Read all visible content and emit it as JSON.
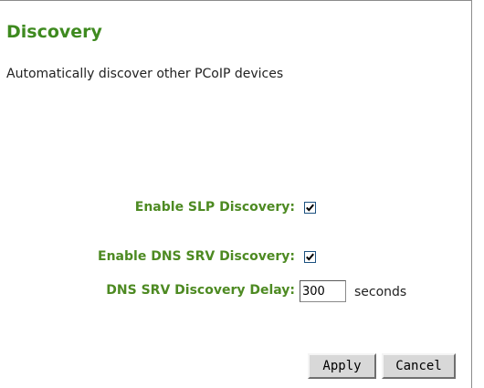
{
  "page": {
    "title": "Discovery",
    "description": "Automatically discover other PCoIP devices"
  },
  "form": {
    "slp": {
      "label": "Enable SLP Discovery:",
      "checked": true
    },
    "dns_srv": {
      "label": "Enable DNS SRV Discovery:",
      "checked": true
    },
    "delay": {
      "label": "DNS SRV Discovery Delay:",
      "value": "300",
      "unit": "seconds"
    }
  },
  "buttons": {
    "apply": "Apply",
    "cancel": "Cancel"
  },
  "colors": {
    "title": "#3e8a1f",
    "label": "#4d8a22"
  }
}
